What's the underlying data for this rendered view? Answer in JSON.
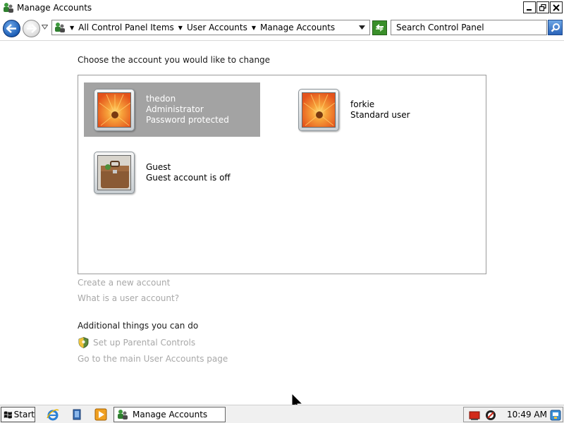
{
  "window": {
    "title": "Manage Accounts"
  },
  "navbar": {
    "breadcrumbs": [
      "All Control Panel Items",
      "User Accounts",
      "Manage Accounts"
    ],
    "search_placeholder": "Search Control Panel"
  },
  "main": {
    "heading": "Choose the account you would like to change",
    "accounts": [
      {
        "name": "thedon",
        "type": "Administrator",
        "status": "Password protected",
        "selected": true
      },
      {
        "name": "forkie",
        "type": "Standard user"
      },
      {
        "name": "Guest",
        "type": "Guest account is off"
      }
    ],
    "links": {
      "create": "Create a new account",
      "what": "What is a user account?"
    },
    "additional_heading": "Additional things you can do",
    "additional_links": {
      "parental": "Set up Parental Controls",
      "main_page": "Go to the main User Accounts page"
    }
  },
  "taskbar": {
    "start_label": "Start",
    "task_label": "Manage Accounts",
    "clock": "10:49 AM"
  },
  "colors": {
    "selection": "#a3a3a3",
    "disabled_link": "#a8a8a8",
    "nav_blue": "#1d5fb7"
  }
}
